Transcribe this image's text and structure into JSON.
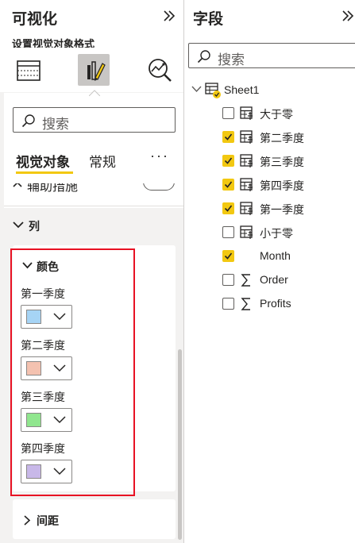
{
  "visualizations": {
    "title": "可视化",
    "subtitle": "设置视觉对象格式",
    "toolbar_icons": [
      "table-grid-icon",
      "format-paintbrush-icon",
      "analytics-magnifier-icon"
    ],
    "search": {
      "placeholder": "搜索"
    },
    "tabs": [
      {
        "label": "视觉对象",
        "active": true
      },
      {
        "label": "常规",
        "active": false
      }
    ],
    "more_label": "···",
    "partial_row_label": "辅助措施",
    "section": {
      "label": "列",
      "expanded": true
    },
    "color_card": {
      "label": "颜色",
      "items": [
        {
          "label": "第一季度",
          "color": "#a6d4f5"
        },
        {
          "label": "第二季度",
          "color": "#f4c2b0"
        },
        {
          "label": "第三季度",
          "color": "#90e68e"
        },
        {
          "label": "第四季度",
          "color": "#c8b8e8"
        }
      ]
    },
    "spacing_card": {
      "label": "间距",
      "expanded": false
    }
  },
  "fields": {
    "title": "字段",
    "search": {
      "placeholder": "搜索"
    },
    "table": {
      "name": "Sheet1",
      "expanded": true
    },
    "items": [
      {
        "name": "大于零",
        "checked": false,
        "icon": "calculated-table-icon"
      },
      {
        "name": "第二季度",
        "checked": true,
        "icon": "calculated-table-icon"
      },
      {
        "name": "第三季度",
        "checked": true,
        "icon": "calculated-table-icon"
      },
      {
        "name": "第四季度",
        "checked": true,
        "icon": "calculated-table-icon"
      },
      {
        "name": "第一季度",
        "checked": true,
        "icon": "calculated-table-icon"
      },
      {
        "name": "小于零",
        "checked": false,
        "icon": "calculated-table-icon"
      },
      {
        "name": "Month",
        "checked": true,
        "icon": "none"
      },
      {
        "name": "Order",
        "checked": false,
        "icon": "sigma-icon"
      },
      {
        "name": "Profits",
        "checked": false,
        "icon": "sigma-icon"
      }
    ]
  },
  "colors": {
    "accent_yellow": "#f2c811",
    "highlight_red": "#e81123",
    "panel_bg": "#f3f2f1"
  }
}
